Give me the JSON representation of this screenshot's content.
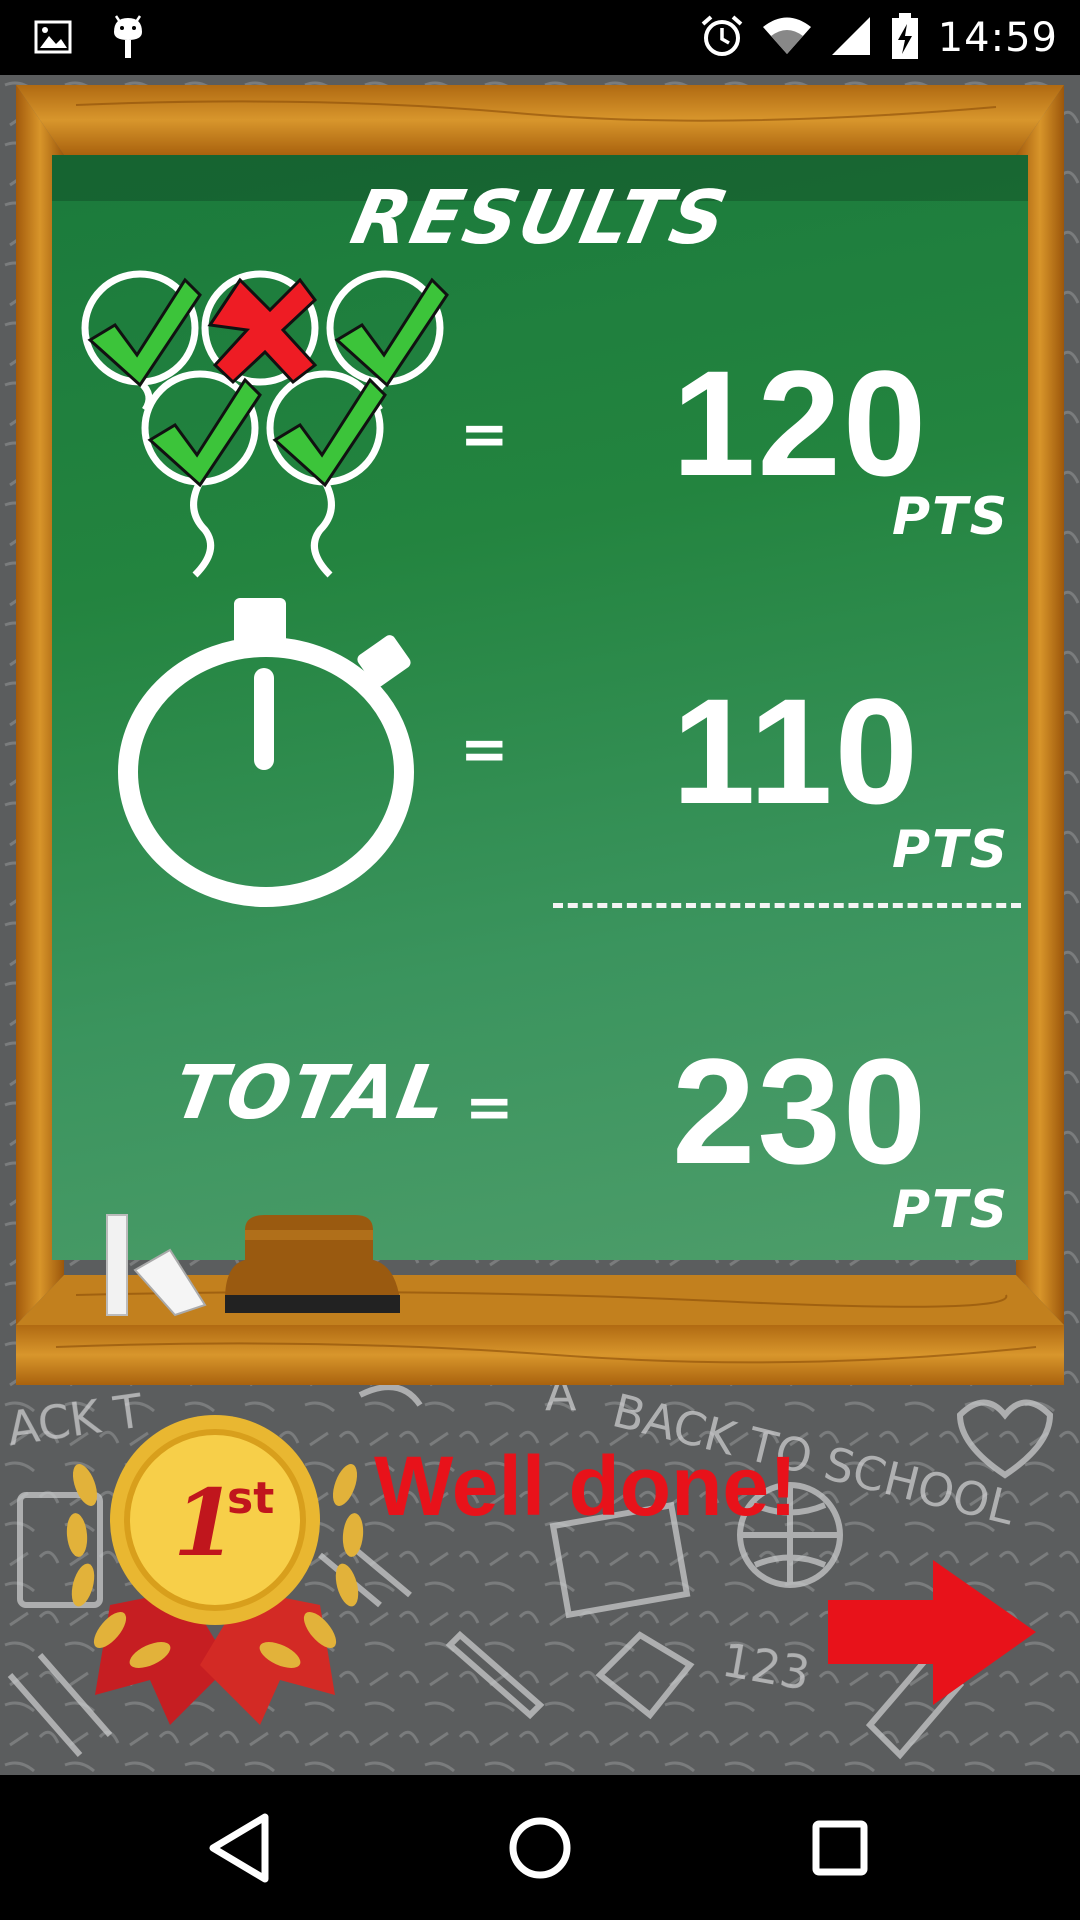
{
  "status_bar": {
    "time": "14:59",
    "icons": [
      "image-icon",
      "android-debug-icon",
      "alarm-icon",
      "wifi-icon",
      "signal-icon",
      "battery-charging-icon"
    ]
  },
  "board": {
    "title": "RESULTS",
    "balloon_results": [
      "check",
      "cross",
      "check",
      "check",
      "check"
    ],
    "balloons_equals": "=",
    "balloons_points": "120",
    "balloons_unit": "PTS",
    "time_equals": "=",
    "time_points": "110",
    "time_unit": "PTS",
    "total_label": "TOTAL",
    "total_equals": "=",
    "total_points": "230",
    "total_unit": "PTS"
  },
  "medal": {
    "text_main": "1",
    "text_sup": "st"
  },
  "message": "Well done!",
  "colors": {
    "board_green": "#1b7a3c",
    "frame_wood": "#c8861e",
    "accent_red": "#e8121a",
    "chalk_white": "#ffffff"
  },
  "navigation": {
    "next": "arrow-right-icon",
    "back": "back-icon",
    "home": "home-icon",
    "recents": "recents-icon"
  }
}
